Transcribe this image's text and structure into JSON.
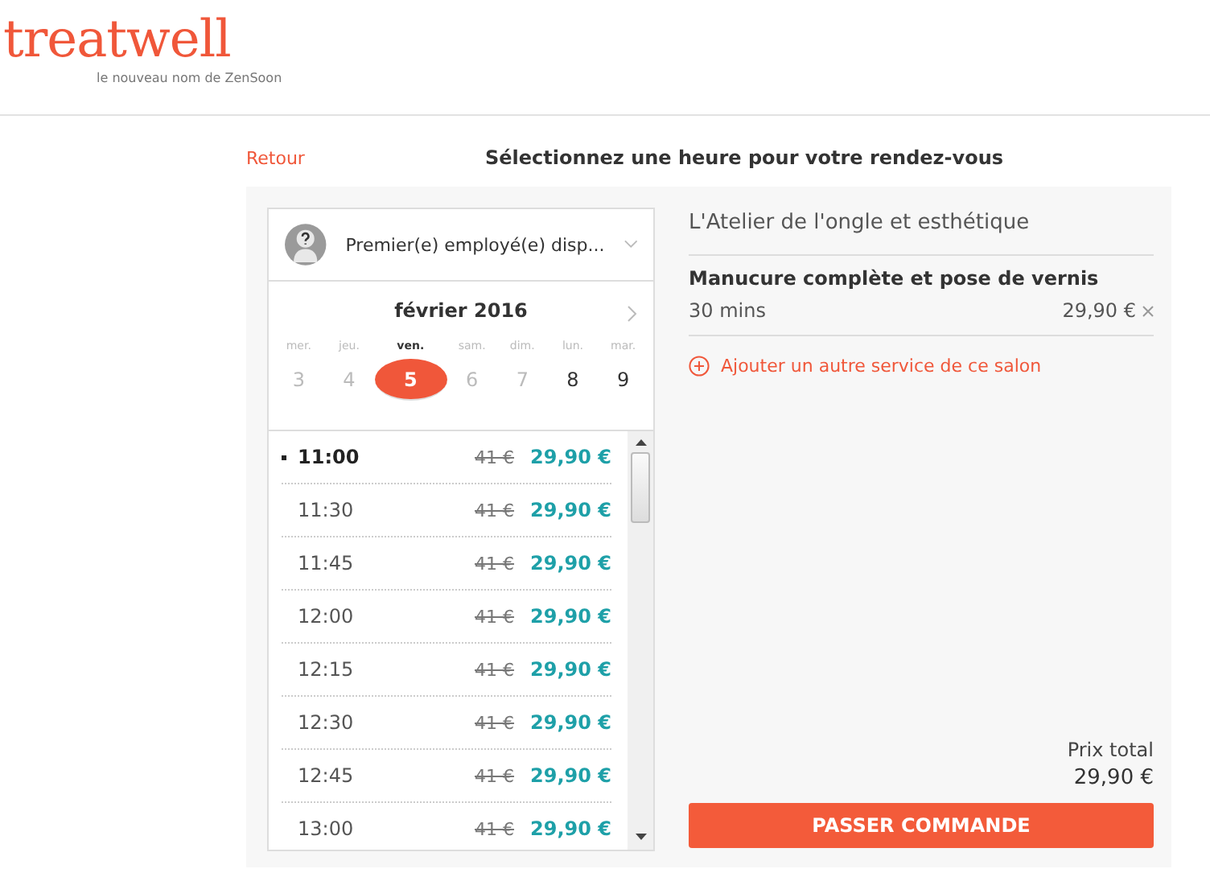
{
  "header": {
    "logo": "treatwell",
    "tagline": "le nouveau nom de ZenSoon"
  },
  "back_link": "Retour",
  "page_title": "Sélectionnez une heure pour votre rendez-vous",
  "employee_select": {
    "value": "Premier(e) employé(e) disp..."
  },
  "calendar": {
    "month": "février 2016",
    "days": [
      {
        "weekday": "mer.",
        "date": "3",
        "available": false,
        "selected": false
      },
      {
        "weekday": "jeu.",
        "date": "4",
        "available": false,
        "selected": false
      },
      {
        "weekday": "ven.",
        "date": "5",
        "available": true,
        "selected": true
      },
      {
        "weekday": "sam.",
        "date": "6",
        "available": false,
        "selected": false
      },
      {
        "weekday": "dim.",
        "date": "7",
        "available": false,
        "selected": false
      },
      {
        "weekday": "lun.",
        "date": "8",
        "available": true,
        "selected": false
      },
      {
        "weekday": "mar.",
        "date": "9",
        "available": true,
        "selected": false
      }
    ]
  },
  "time_slots": [
    {
      "time": "11:00",
      "old_price": "41 €",
      "price": "29,90 €",
      "selected": true
    },
    {
      "time": "11:30",
      "old_price": "41 €",
      "price": "29,90 €",
      "selected": false
    },
    {
      "time": "11:45",
      "old_price": "41 €",
      "price": "29,90 €",
      "selected": false
    },
    {
      "time": "12:00",
      "old_price": "41 €",
      "price": "29,90 €",
      "selected": false
    },
    {
      "time": "12:15",
      "old_price": "41 €",
      "price": "29,90 €",
      "selected": false
    },
    {
      "time": "12:30",
      "old_price": "41 €",
      "price": "29,90 €",
      "selected": false
    },
    {
      "time": "12:45",
      "old_price": "41 €",
      "price": "29,90 €",
      "selected": false
    },
    {
      "time": "13:00",
      "old_price": "41 €",
      "price": "29,90 €",
      "selected": false
    }
  ],
  "summary": {
    "salon": "L'Atelier de l'ongle et esthétique",
    "services": [
      {
        "name": "Manucure complète et pose de vernis",
        "duration": "30 mins",
        "price": "29,90 €"
      }
    ],
    "add_service": "Ajouter un autre service de ce salon",
    "total_label": "Prix total",
    "total": "29,90 €",
    "order_button": "PASSER COMMANDE"
  }
}
